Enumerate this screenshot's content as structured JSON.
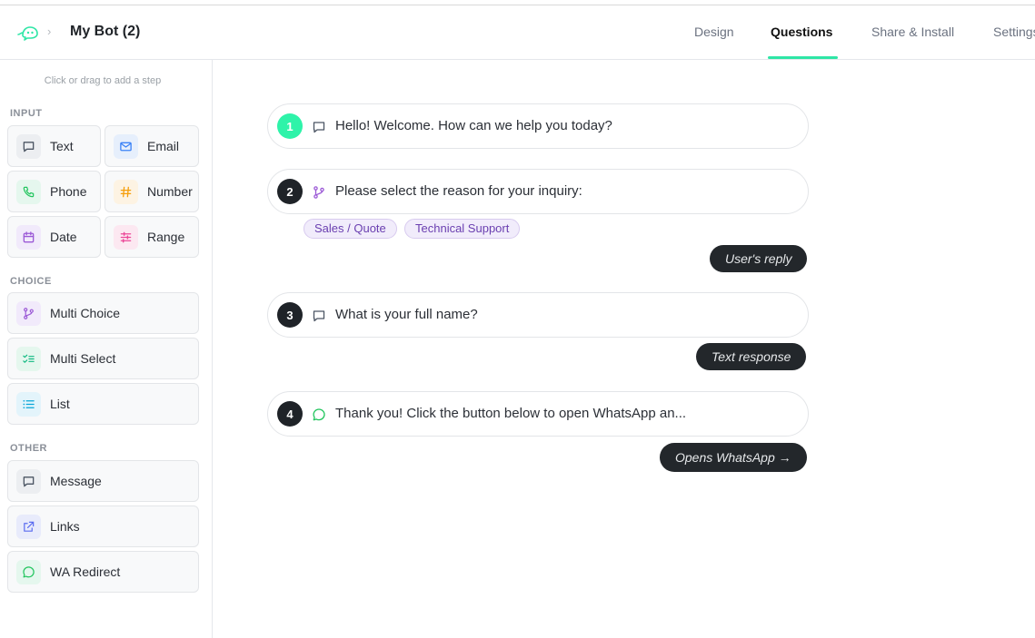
{
  "header": {
    "bot_name": "My Bot (2)",
    "separator": "›",
    "tabs": [
      {
        "label": "Design"
      },
      {
        "label": "Questions"
      },
      {
        "label": "Share & Install"
      },
      {
        "label": "Settings"
      }
    ],
    "active_tab": "Questions",
    "accent_color": "#2ee6a6"
  },
  "sidebar": {
    "hint": "Click or drag to add a step",
    "sections": [
      {
        "label": "INPUT",
        "items": [
          {
            "label": "Text",
            "icon": "message-square-icon"
          },
          {
            "label": "Email",
            "icon": "mail-icon"
          },
          {
            "label": "Phone",
            "icon": "phone-icon"
          },
          {
            "label": "Number",
            "icon": "hash-icon"
          },
          {
            "label": "Date",
            "icon": "calendar-icon"
          },
          {
            "label": "Range",
            "icon": "sliders-icon"
          }
        ]
      },
      {
        "label": "CHOICE",
        "items": [
          {
            "label": "Multi Choice",
            "icon": "git-branch-icon"
          },
          {
            "label": "Multi Select",
            "icon": "list-checks-icon"
          },
          {
            "label": "List",
            "icon": "list-icon"
          }
        ]
      },
      {
        "label": "OTHER",
        "items": [
          {
            "label": "Message",
            "icon": "message-square-icon"
          },
          {
            "label": "Links",
            "icon": "external-link-icon"
          },
          {
            "label": "WA Redirect",
            "icon": "whatsapp-icon"
          }
        ]
      }
    ]
  },
  "flow": {
    "steps": [
      {
        "number": "1",
        "icon": "message-square-icon",
        "text": "Hello! Welcome. How can we help you today?"
      },
      {
        "number": "2",
        "icon": "git-branch-icon",
        "text": "Please select the reason for your inquiry:",
        "options": [
          "Sales / Quote",
          "Technical Support"
        ],
        "reply_label": "User's reply"
      },
      {
        "number": "3",
        "icon": "message-square-icon",
        "text": "What is your full name?",
        "reply_label": "Text response"
      },
      {
        "number": "4",
        "icon": "whatsapp-icon",
        "text": "Thank you! Click the button below to open WhatsApp an...",
        "reply_label": "Opens WhatsApp →"
      }
    ]
  }
}
